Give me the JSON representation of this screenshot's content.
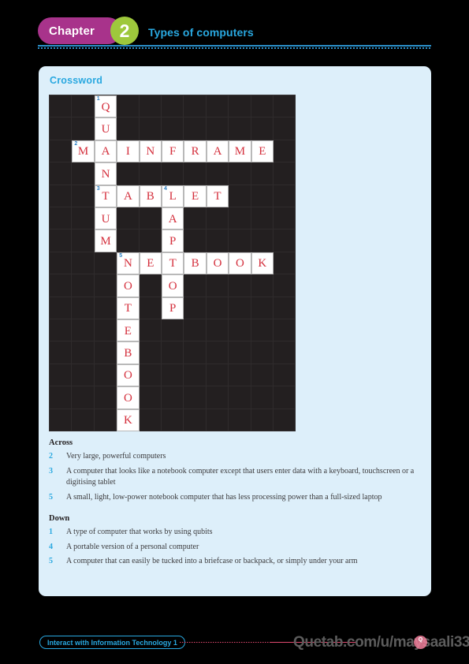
{
  "header": {
    "chapter_label": "Chapter",
    "chapter_number": "2",
    "title": "Types of computers",
    "badge_color": "#a8338b",
    "number_circle_color": "#9ec83c",
    "title_color": "#29a8e0",
    "rule_color": "#2b8fc9"
  },
  "panel": {
    "title": "Crossword",
    "background_color": "#ddeffa",
    "title_color": "#29a8e0"
  },
  "grid": {
    "columns": 11,
    "rows": 15,
    "cell_size": 28.4,
    "background_color": "#231f20",
    "letter_color": "#d42f3c",
    "number_color": "#2b7fc4",
    "cells": [
      {
        "row": 0,
        "col": 2,
        "letter": "Q",
        "number": "1"
      },
      {
        "row": 1,
        "col": 2,
        "letter": "U",
        "number": ""
      },
      {
        "row": 2,
        "col": 1,
        "letter": "M",
        "number": "2"
      },
      {
        "row": 2,
        "col": 2,
        "letter": "A",
        "number": ""
      },
      {
        "row": 2,
        "col": 3,
        "letter": "I",
        "number": ""
      },
      {
        "row": 2,
        "col": 4,
        "letter": "N",
        "number": ""
      },
      {
        "row": 2,
        "col": 5,
        "letter": "F",
        "number": ""
      },
      {
        "row": 2,
        "col": 6,
        "letter": "R",
        "number": ""
      },
      {
        "row": 2,
        "col": 7,
        "letter": "A",
        "number": ""
      },
      {
        "row": 2,
        "col": 8,
        "letter": "M",
        "number": ""
      },
      {
        "row": 2,
        "col": 9,
        "letter": "E",
        "number": ""
      },
      {
        "row": 3,
        "col": 2,
        "letter": "N",
        "number": ""
      },
      {
        "row": 4,
        "col": 2,
        "letter": "T",
        "number": "3"
      },
      {
        "row": 4,
        "col": 3,
        "letter": "A",
        "number": ""
      },
      {
        "row": 4,
        "col": 4,
        "letter": "B",
        "number": ""
      },
      {
        "row": 4,
        "col": 5,
        "letter": "L",
        "number": "4"
      },
      {
        "row": 4,
        "col": 6,
        "letter": "E",
        "number": ""
      },
      {
        "row": 4,
        "col": 7,
        "letter": "T",
        "number": ""
      },
      {
        "row": 5,
        "col": 2,
        "letter": "U",
        "number": ""
      },
      {
        "row": 5,
        "col": 5,
        "letter": "A",
        "number": ""
      },
      {
        "row": 6,
        "col": 2,
        "letter": "M",
        "number": ""
      },
      {
        "row": 6,
        "col": 5,
        "letter": "P",
        "number": ""
      },
      {
        "row": 7,
        "col": 3,
        "letter": "N",
        "number": "5"
      },
      {
        "row": 7,
        "col": 4,
        "letter": "E",
        "number": ""
      },
      {
        "row": 7,
        "col": 5,
        "letter": "T",
        "number": ""
      },
      {
        "row": 7,
        "col": 6,
        "letter": "B",
        "number": ""
      },
      {
        "row": 7,
        "col": 7,
        "letter": "O",
        "number": ""
      },
      {
        "row": 7,
        "col": 8,
        "letter": "O",
        "number": ""
      },
      {
        "row": 7,
        "col": 9,
        "letter": "K",
        "number": ""
      },
      {
        "row": 8,
        "col": 3,
        "letter": "O",
        "number": ""
      },
      {
        "row": 8,
        "col": 5,
        "letter": "O",
        "number": ""
      },
      {
        "row": 9,
        "col": 3,
        "letter": "T",
        "number": ""
      },
      {
        "row": 9,
        "col": 5,
        "letter": "P",
        "number": ""
      },
      {
        "row": 10,
        "col": 3,
        "letter": "E",
        "number": ""
      },
      {
        "row": 11,
        "col": 3,
        "letter": "B",
        "number": ""
      },
      {
        "row": 12,
        "col": 3,
        "letter": "O",
        "number": ""
      },
      {
        "row": 13,
        "col": 3,
        "letter": "O",
        "number": ""
      },
      {
        "row": 14,
        "col": 3,
        "letter": "K",
        "number": ""
      }
    ]
  },
  "clues": {
    "across_heading": "Across",
    "across": [
      {
        "number": "2",
        "text": "Very large, powerful computers"
      },
      {
        "number": "3",
        "text": "A computer that looks like a notebook computer except that users enter data with a keyboard, touchscreen or a digitising tablet"
      },
      {
        "number": "5",
        "text": "A small, light, low-power notebook computer that has less processing power than a full-sized laptop"
      }
    ],
    "down_heading": "Down",
    "down": [
      {
        "number": "1",
        "text": "A type of computer that works by using qubits"
      },
      {
        "number": "4",
        "text": "A portable version of a personal computer"
      },
      {
        "number": "5",
        "text": "A computer that can easily be tucked into a briefcase or backpack, or simply under your arm"
      }
    ]
  },
  "footer": {
    "badge_label": "Interact with Information Technology 1",
    "watermark": "Quetab.com/u/maysaali33",
    "watermark_dot_label": "Q",
    "line_color": "#e0496f",
    "badge_color": "#29a8e0"
  }
}
